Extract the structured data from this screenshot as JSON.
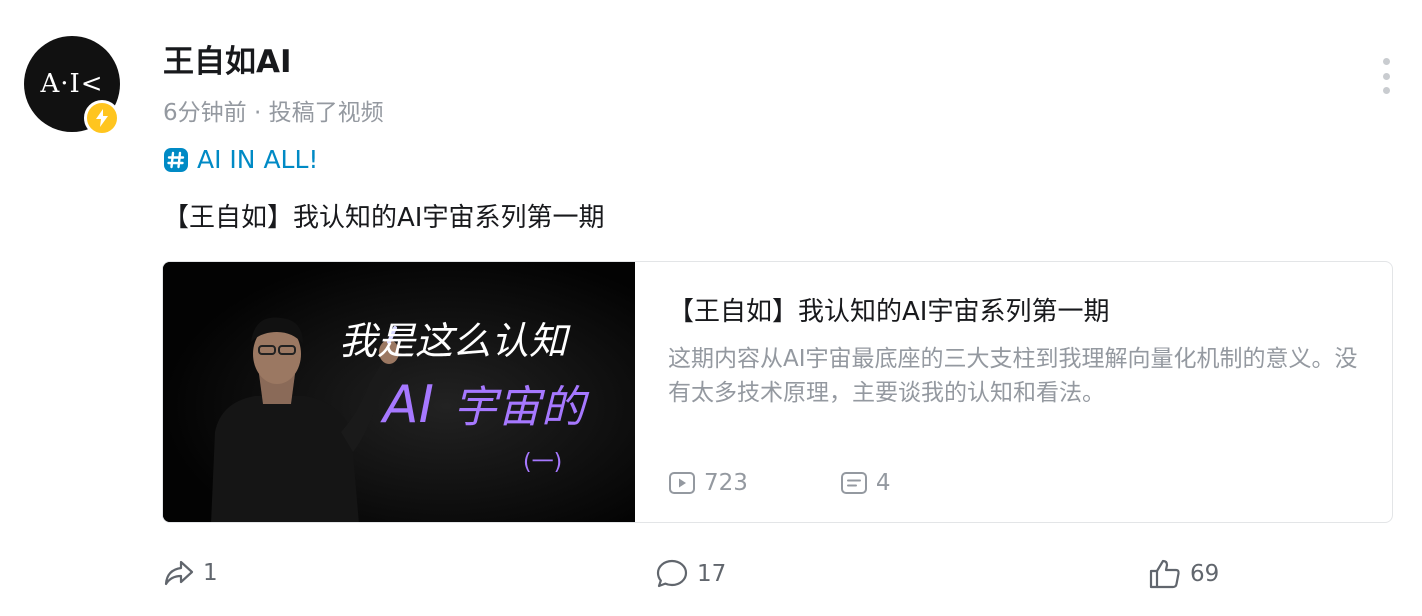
{
  "author": {
    "avatar_text": "A·I<",
    "badge_icon": "lightning-icon",
    "name": "王自如AI",
    "meta": "6分钟前 · 投稿了视频"
  },
  "topic": {
    "icon": "hashtag-icon",
    "label": "AI IN ALL!"
  },
  "post_text": "【王自如】我认知的AI宇宙系列第一期",
  "video_card": {
    "cover_text": {
      "line1": "我是这么认知",
      "line2_highlight": "AI",
      "line2_rest": "宇宙的",
      "line3": "(一)"
    },
    "title": "【王自如】我认知的AI宇宙系列第一期",
    "description": "这期内容从AI宇宙最底座的三大支柱到我理解向量化机制的意义。没有太多技术原理，主要谈我的认知和看法。",
    "play_count": "723",
    "danmaku_count": "4"
  },
  "actions": {
    "forward_count": "1",
    "comment_count": "17",
    "like_count": "69"
  },
  "colors": {
    "topic_blue": "#008ac5",
    "badge_yellow": "#ffc51f",
    "secondary_gray": "#9499a0",
    "cover_purple": "#a678ff"
  }
}
